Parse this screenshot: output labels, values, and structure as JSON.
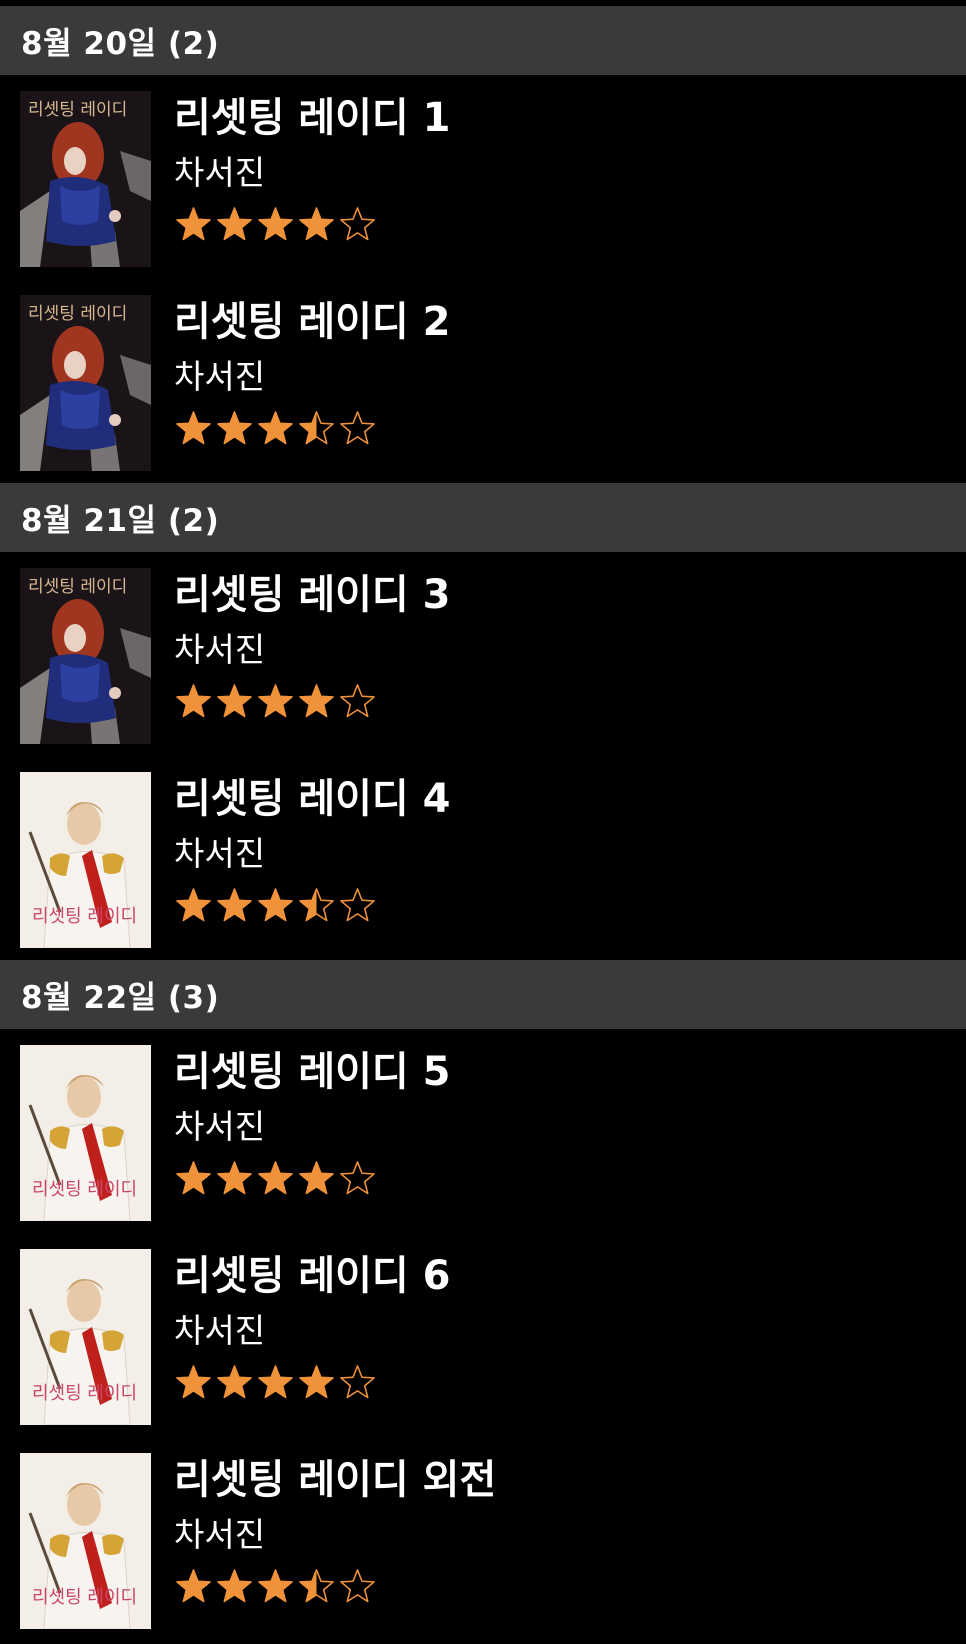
{
  "sections": [
    {
      "header": "8월 20일 (2)",
      "items": [
        {
          "title": "리셋팅 레이디 1",
          "author": "차서진",
          "rating": 4.0,
          "cover": "dark"
        },
        {
          "title": "리셋팅 레이디 2",
          "author": "차서진",
          "rating": 3.5,
          "cover": "dark"
        }
      ]
    },
    {
      "header": "8월 21일 (2)",
      "items": [
        {
          "title": "리셋팅 레이디 3",
          "author": "차서진",
          "rating": 4.0,
          "cover": "dark"
        },
        {
          "title": "리셋팅 레이디 4",
          "author": "차서진",
          "rating": 3.5,
          "cover": "light"
        }
      ]
    },
    {
      "header": "8월 22일 (3)",
      "items": [
        {
          "title": "리셋팅 레이디 5",
          "author": "차서진",
          "rating": 4.0,
          "cover": "light"
        },
        {
          "title": "리셋팅 레이디 6",
          "author": "차서진",
          "rating": 4.0,
          "cover": "light"
        },
        {
          "title": "리셋팅 레이디 외전",
          "author": "차서진",
          "rating": 3.5,
          "cover": "light"
        }
      ]
    }
  ],
  "colors": {
    "background": "#000000",
    "section_header": "#3a3a3c",
    "star": "#f0923a",
    "text": "#ffffff"
  },
  "cover_lettering": {
    "dark": "리셋팅 레이디",
    "light": "리셋팅 레이디"
  }
}
